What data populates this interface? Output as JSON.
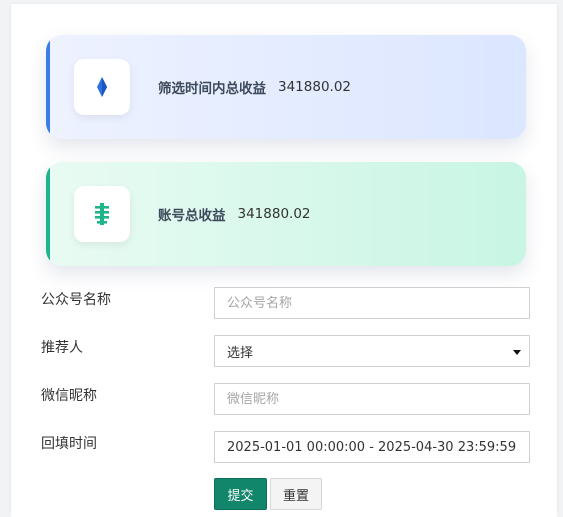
{
  "colors": {
    "accent_blue": "#3b7de8",
    "accent_green": "#1fb58a",
    "primary_button": "#11866b"
  },
  "stats": [
    {
      "label": "筛选时间内总收益",
      "value": "341880.02",
      "icon": "diamond-icon"
    },
    {
      "label": "账号总收益",
      "value": "341880.02",
      "icon": "yen-icon"
    }
  ],
  "form": {
    "account_name": {
      "label": "公众号名称",
      "placeholder": "公众号名称",
      "value": ""
    },
    "referrer": {
      "label": "推荐人",
      "selected": "选择"
    },
    "wechat_nickname": {
      "label": "微信昵称",
      "placeholder": "微信昵称",
      "value": ""
    },
    "fill_time": {
      "label": "回填时间",
      "value": "2025-01-01 00:00:00 - 2025-04-30 23:59:59"
    },
    "submit_label": "提交",
    "reset_label": "重置"
  }
}
